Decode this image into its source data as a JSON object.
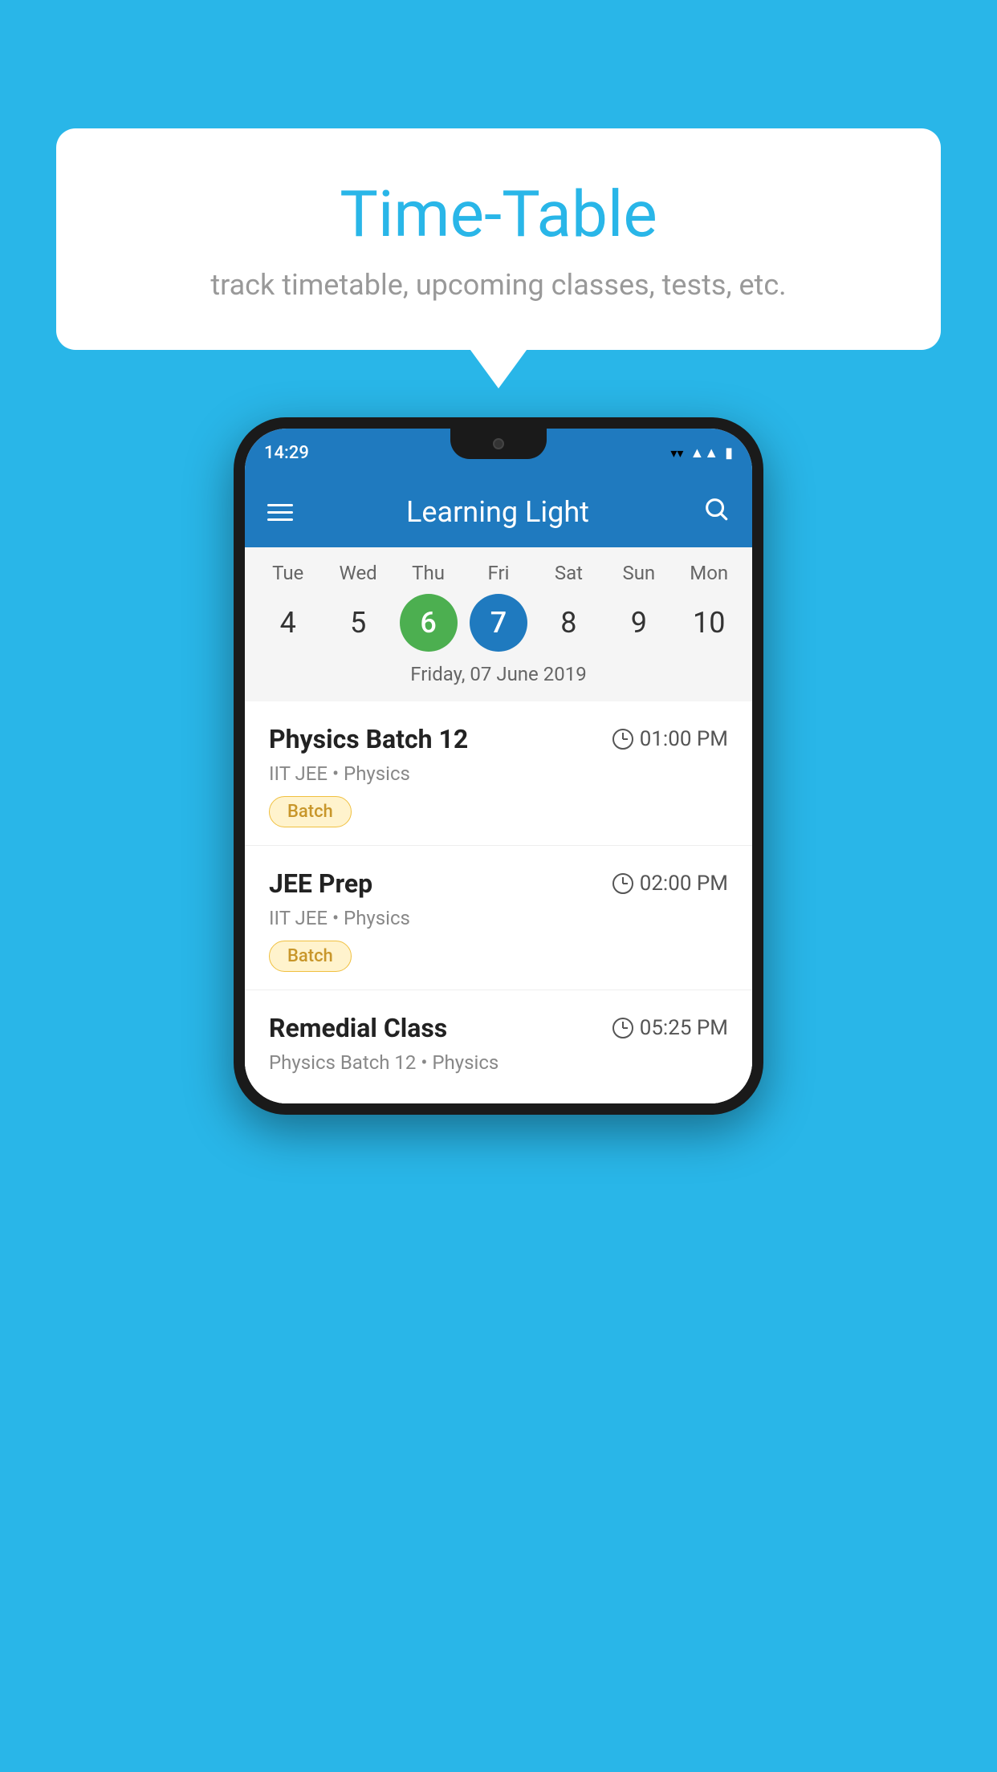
{
  "background_color": "#29B6E8",
  "speech_bubble": {
    "title": "Time-Table",
    "subtitle": "track timetable, upcoming classes, tests, etc."
  },
  "phone": {
    "status_bar": {
      "time": "14:29"
    },
    "app_bar": {
      "title": "Learning Light"
    },
    "calendar": {
      "days": [
        {
          "label": "Tue",
          "num": "4"
        },
        {
          "label": "Wed",
          "num": "5"
        },
        {
          "label": "Thu",
          "num": "6",
          "state": "today"
        },
        {
          "label": "Fri",
          "num": "7",
          "state": "selected"
        },
        {
          "label": "Sat",
          "num": "8"
        },
        {
          "label": "Sun",
          "num": "9"
        },
        {
          "label": "Mon",
          "num": "10"
        }
      ],
      "selected_date_label": "Friday, 07 June 2019"
    },
    "classes": [
      {
        "name": "Physics Batch 12",
        "time": "01:00 PM",
        "meta": "IIT JEE • Physics",
        "badge": "Batch"
      },
      {
        "name": "JEE Prep",
        "time": "02:00 PM",
        "meta": "IIT JEE • Physics",
        "badge": "Batch"
      },
      {
        "name": "Remedial Class",
        "time": "05:25 PM",
        "meta": "Physics Batch 12 • Physics",
        "badge": null
      }
    ]
  }
}
